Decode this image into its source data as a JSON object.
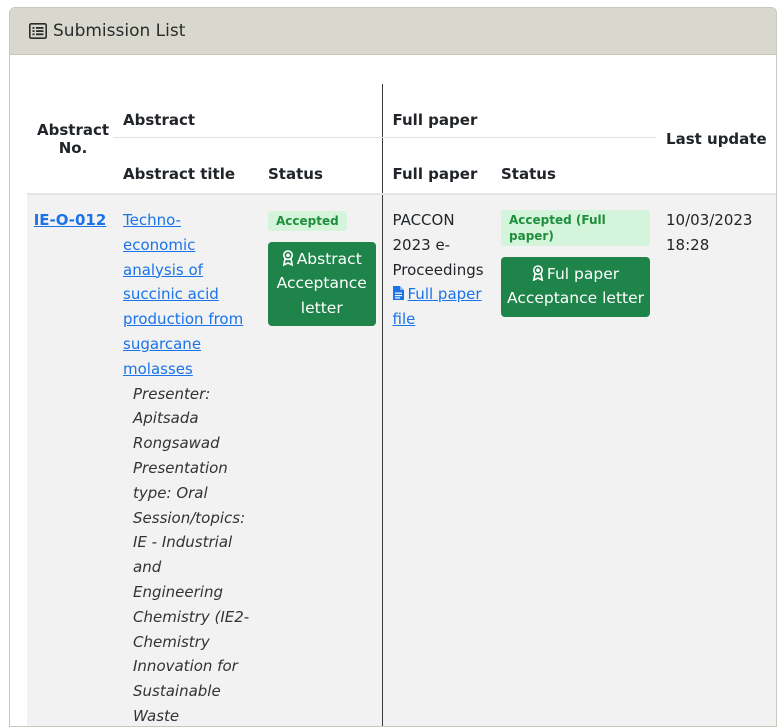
{
  "header": {
    "title": "Submission List",
    "icon": "list-icon"
  },
  "table": {
    "headers": {
      "abstract_no": "Abstract No.",
      "abstract_group": "Abstract",
      "abstract_title": "Abstract title",
      "abstract_status": "Status",
      "fullpaper_group": "Full paper",
      "fullpaper": "Full paper",
      "fullpaper_status": "Status",
      "last_update": "Last update"
    },
    "rows": [
      {
        "abstract_no": "IE-O-012",
        "abstract_title": "Techno-economic analysis of succinic acid production from sugarcane molasses",
        "presenter": "Presenter: Apitsada Rongsawad",
        "presentation_type": "Presentation type: Oral",
        "session": "Session/topics: IE - Industrial and Engineering Chemistry (IE2-Chemistry Innovation for Sustainable Waste Management)",
        "abstract_status": "Accepted",
        "abstract_letter_button": "Abstract Acceptance letter",
        "fullpaper_text": "PACCON 2023 e-Proceedings",
        "fullpaper_link": "Full paper file",
        "fullpaper_status": "Accepted (Full paper)",
        "fullpaper_letter_button": "Ful paper Acceptance letter",
        "last_update": "10/03/2023 18:28"
      }
    ]
  },
  "colors": {
    "accent_green": "#1e8449",
    "badge_bg": "#d4f4dc",
    "badge_text": "#1e8f3a",
    "link": "#1a73e8"
  }
}
